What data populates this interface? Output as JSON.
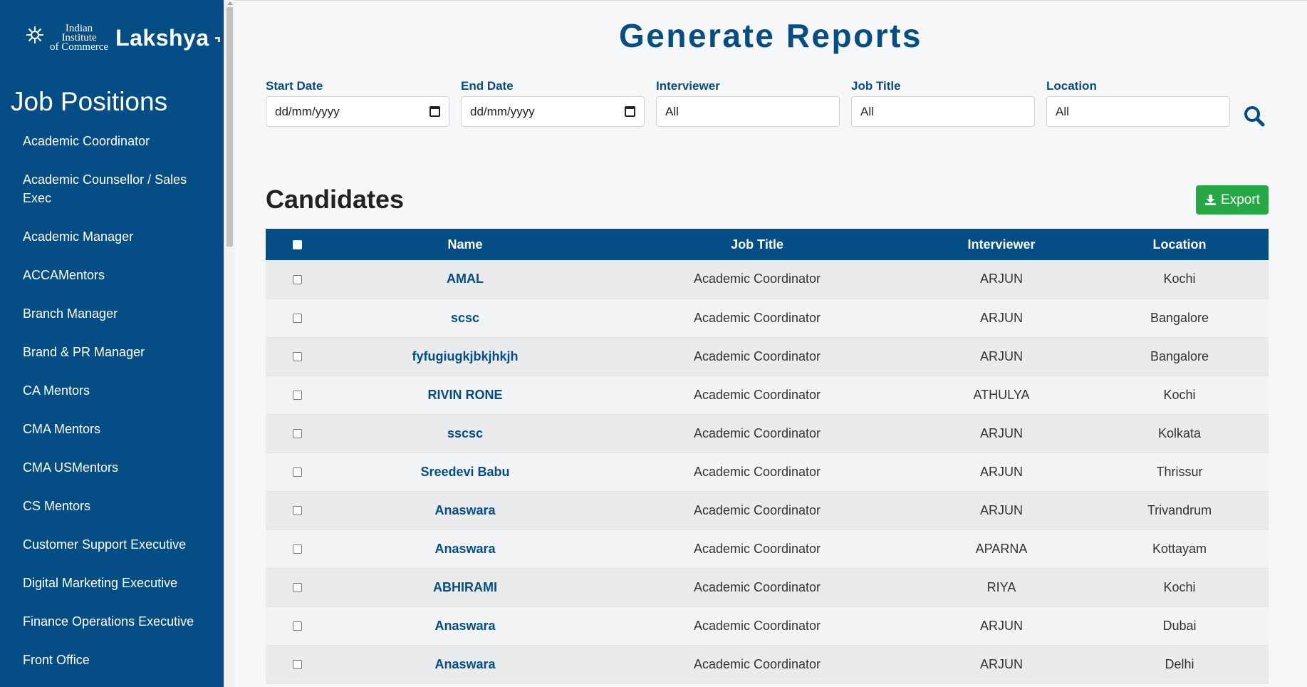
{
  "sidebar": {
    "logo": {
      "line1": "Indian",
      "line2": "Institute",
      "line3": "of Commerce",
      "brand": "Lakshya"
    },
    "title": "Job Positions",
    "items": [
      "Academic Coordinator",
      "Academic Counsellor / Sales Exec",
      "Academic Manager",
      "ACCAMentors",
      "Branch Manager",
      "Brand & PR Manager",
      "CA Mentors",
      "CMA Mentors",
      "CMA USMentors",
      "CS Mentors",
      "Customer Support Executive",
      "Digital Marketing Executive",
      "Finance Operations Executive",
      "Front Office"
    ]
  },
  "main": {
    "title": "Generate Reports",
    "filters": {
      "start_date": {
        "label": "Start Date",
        "placeholder": "dd/mm/yyyy"
      },
      "end_date": {
        "label": "End Date",
        "placeholder": "dd/mm/yyyy"
      },
      "interviewer": {
        "label": "Interviewer",
        "value": "All"
      },
      "job_title": {
        "label": "Job Title",
        "value": "All"
      },
      "location": {
        "label": "Location",
        "value": "All"
      }
    },
    "section_title": "Candidates",
    "export_label": "Export",
    "table": {
      "headers": [
        "Name",
        "Job Title",
        "Interviewer",
        "Location"
      ],
      "rows": [
        [
          "AMAL",
          "Academic Coordinator",
          "ARJUN",
          "Kochi"
        ],
        [
          "scsc",
          "Academic Coordinator",
          "ARJUN",
          "Bangalore"
        ],
        [
          "fyfugiugkjbkjhkjh",
          "Academic Coordinator",
          "ARJUN",
          "Bangalore"
        ],
        [
          "RIVIN RONE",
          "Academic Coordinator",
          "ATHULYA",
          "Kochi"
        ],
        [
          "sscsc",
          "Academic Coordinator",
          "ARJUN",
          "Kolkata"
        ],
        [
          "Sreedevi Babu",
          "Academic Coordinator",
          "ARJUN",
          "Thrissur"
        ],
        [
          "Anaswara",
          "Academic Coordinator",
          "ARJUN",
          "Trivandrum"
        ],
        [
          "Anaswara",
          "Academic Coordinator",
          "APARNA",
          "Kottayam"
        ],
        [
          "ABHIRAMI",
          "Academic Coordinator",
          "RIYA",
          "Kochi"
        ],
        [
          "Anaswara",
          "Academic Coordinator",
          "ARJUN",
          "Dubai"
        ],
        [
          "Anaswara",
          "Academic Coordinator",
          "ARJUN",
          "Delhi"
        ]
      ]
    }
  },
  "colors": {
    "primary": "#054e85",
    "export": "#28a745"
  }
}
